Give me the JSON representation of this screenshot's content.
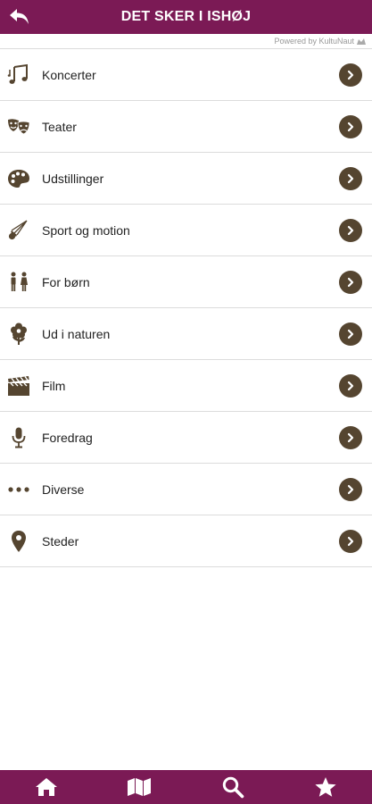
{
  "header": {
    "title": "DET SKER I ISHØJ",
    "powered_by": "Powered by KultuNaut"
  },
  "colors": {
    "brand": "#7b1a55",
    "icon": "#554530",
    "chevron_bg": "#554530"
  },
  "categories": [
    {
      "label": "Koncerter",
      "icon": "music-notes-icon"
    },
    {
      "label": "Teater",
      "icon": "theater-masks-icon"
    },
    {
      "label": "Udstillinger",
      "icon": "palette-icon"
    },
    {
      "label": "Sport og motion",
      "icon": "shuttlecock-icon"
    },
    {
      "label": "For børn",
      "icon": "children-icon"
    },
    {
      "label": "Ud i naturen",
      "icon": "flower-icon"
    },
    {
      "label": "Film",
      "icon": "clapperboard-icon"
    },
    {
      "label": "Foredrag",
      "icon": "microphone-icon"
    },
    {
      "label": "Diverse",
      "icon": "dots-icon"
    },
    {
      "label": "Steder",
      "icon": "map-pin-icon"
    }
  ],
  "bottom_nav": [
    {
      "icon": "home-icon"
    },
    {
      "icon": "map-icon"
    },
    {
      "icon": "search-icon"
    },
    {
      "icon": "star-icon"
    }
  ]
}
